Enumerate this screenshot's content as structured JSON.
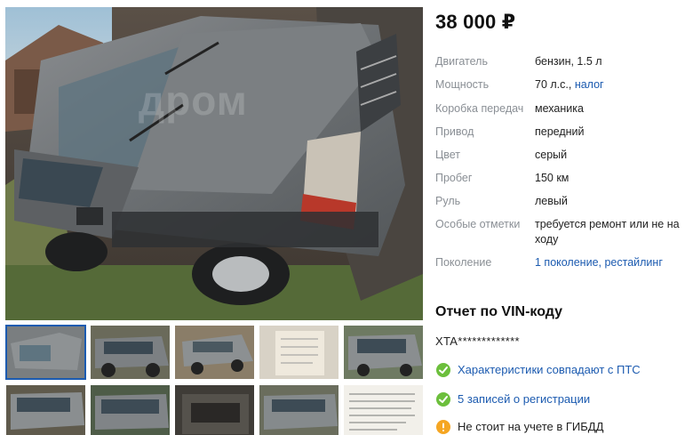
{
  "listing": {
    "price": "38 000 ₽",
    "watermark": "дром"
  },
  "specs": [
    {
      "label": "Двигатель",
      "value": "бензин, 1.5 л",
      "link": ""
    },
    {
      "label": "Мощность",
      "value": "70 л.с., ",
      "link": "налог"
    },
    {
      "label": "Коробка передач",
      "value": "механика",
      "link": ""
    },
    {
      "label": "Привод",
      "value": "передний",
      "link": ""
    },
    {
      "label": "Цвет",
      "value": "серый",
      "link": ""
    },
    {
      "label": "Пробег",
      "value": "150 км",
      "link": ""
    },
    {
      "label": "Руль",
      "value": "левый",
      "link": ""
    },
    {
      "label": "Особые отметки",
      "value": "требуется ремонт или не на ходу",
      "link": ""
    },
    {
      "label": "Поколение",
      "value": "",
      "link": "1 поколение, рестайлинг"
    }
  ],
  "vin_report": {
    "title": "Отчет по VIN-коду",
    "vin": "XTA*************",
    "checks": [
      {
        "text": "Характеристики совпадают с ПТС",
        "status": "ok",
        "icon": "checkmark-icon"
      },
      {
        "text": "5 записей о регистрации",
        "status": "ok",
        "icon": "checkmark-icon"
      },
      {
        "text": "Не стоит на учете в ГИБДД",
        "status": "warn",
        "icon": "exclamation-icon"
      }
    ]
  },
  "colors": {
    "link": "#1c5bb0",
    "ok": "#6cbf3c",
    "warn": "#f5a623",
    "label": "#8a8f95"
  }
}
